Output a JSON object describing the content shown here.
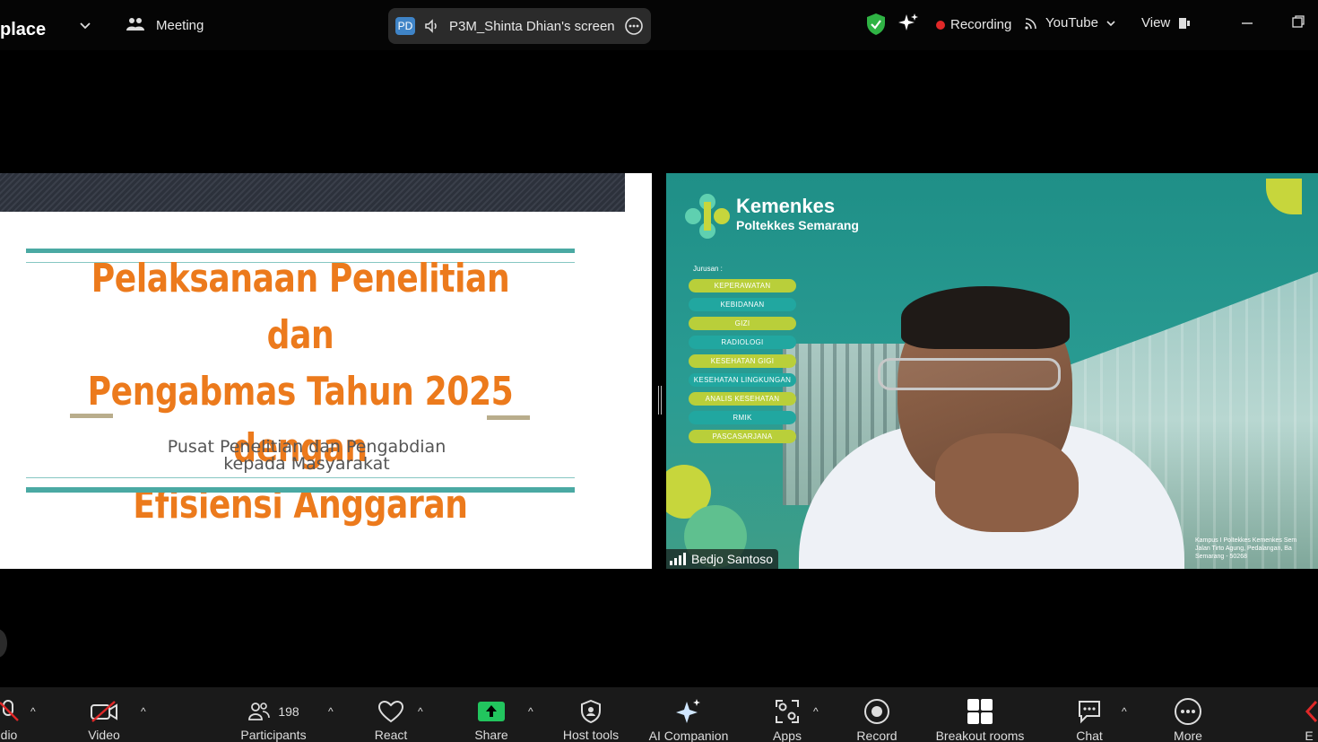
{
  "topbar": {
    "app_name": "place",
    "meeting_label": "Meeting",
    "share_badge": "PD",
    "share_title": "P3M_Shinta Dhian's screen",
    "recording_label": "Recording",
    "stream_label": "YouTube",
    "view_label": "View"
  },
  "slide": {
    "title_line1": "Pelaksanaan Penelitian dan",
    "title_line2": "Pengabmas Tahun 2025 dengan",
    "title_line3": "Efisiensi Anggaran",
    "subtitle_line1": "Pusat Penelitian dan Pengabdian",
    "subtitle_line2": "kepada Masyarakat"
  },
  "video": {
    "brand": "Kemenkes",
    "brand_sub": "Poltekkes Semarang",
    "jurusan_label": "Jurusan :",
    "departments": [
      "KEPERAWATAN",
      "KEBIDANAN",
      "GIZI",
      "RADIOLOGI",
      "KESEHATAN GIGI",
      "KESEHATAN LINGKUNGAN",
      "ANALIS KESEHATAN",
      "RMIK",
      "PASCASARJANA"
    ],
    "caption_line1": "Kampus I Poltekkes Kemenkes Sem",
    "caption_line2": "Jalan Tirto Agung, Pedalangan, Ba",
    "caption_line3": "Semarang - 50268",
    "participant_name": "Bedjo Santoso"
  },
  "toolbar": {
    "audio_label": "dio",
    "video_label": "Video",
    "participants_label": "Participants",
    "participants_count": "198",
    "react_label": "React",
    "share_label": "Share",
    "host_tools_label": "Host tools",
    "ai_label": "AI Companion",
    "apps_label": "Apps",
    "record_label": "Record",
    "breakout_label": "Breakout rooms",
    "chat_label": "Chat",
    "more_label": "More",
    "end_label": "E"
  },
  "colors": {
    "share_green": "#22c55e",
    "security_green": "#2fb344",
    "recording_red": "#e02828",
    "slide_orange": "#ec7a1c",
    "slide_teal": "#4aa9a3"
  }
}
